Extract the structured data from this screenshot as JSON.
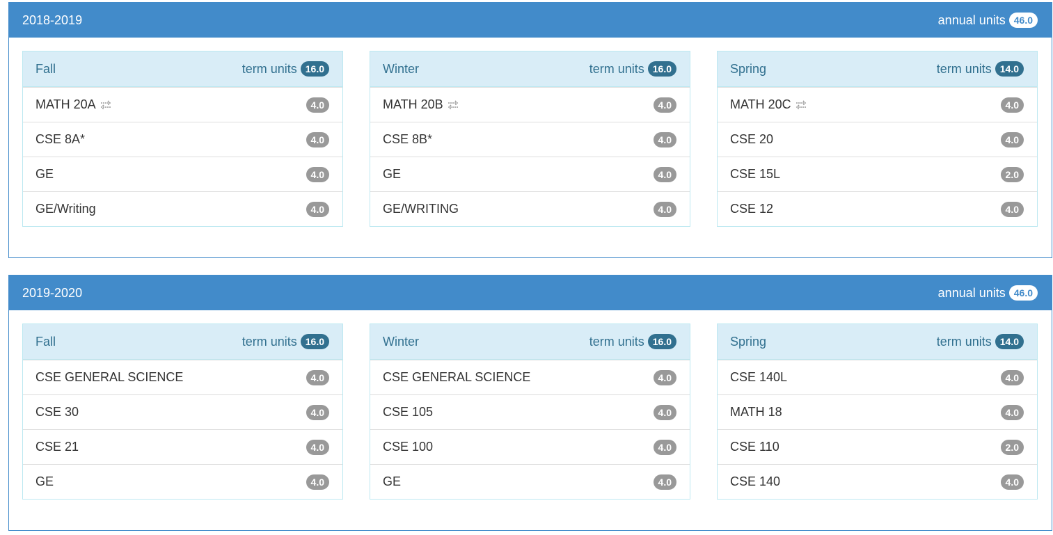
{
  "years": [
    {
      "label": "2018-2019",
      "annual_label": "annual units",
      "annual_units": "46.0",
      "terms": [
        {
          "name": "Fall",
          "units_label": "term units",
          "units": "16.0",
          "courses": [
            {
              "name": "MATH 20A",
              "units": "4.0",
              "icon": "swap-arrows-icon"
            },
            {
              "name": "CSE 8A*",
              "units": "4.0"
            },
            {
              "name": "GE",
              "units": "4.0"
            },
            {
              "name": "GE/Writing",
              "units": "4.0"
            }
          ]
        },
        {
          "name": "Winter",
          "units_label": "term units",
          "units": "16.0",
          "courses": [
            {
              "name": "MATH 20B",
              "units": "4.0",
              "icon": "swap-arrows-icon"
            },
            {
              "name": "CSE 8B*",
              "units": "4.0"
            },
            {
              "name": "GE",
              "units": "4.0"
            },
            {
              "name": "GE/WRITING",
              "units": "4.0"
            }
          ]
        },
        {
          "name": "Spring",
          "units_label": "term units",
          "units": "14.0",
          "courses": [
            {
              "name": "MATH 20C",
              "units": "4.0",
              "icon": "swap-arrows-icon"
            },
            {
              "name": "CSE 20",
              "units": "4.0"
            },
            {
              "name": "CSE 15L",
              "units": "2.0"
            },
            {
              "name": "CSE 12",
              "units": "4.0"
            }
          ]
        }
      ]
    },
    {
      "label": "2019-2020",
      "annual_label": "annual units",
      "annual_units": "46.0",
      "terms": [
        {
          "name": "Fall",
          "units_label": "term units",
          "units": "16.0",
          "courses": [
            {
              "name": "CSE GENERAL SCIENCE",
              "units": "4.0"
            },
            {
              "name": "CSE 30",
              "units": "4.0"
            },
            {
              "name": "CSE 21",
              "units": "4.0"
            },
            {
              "name": "GE",
              "units": "4.0"
            }
          ]
        },
        {
          "name": "Winter",
          "units_label": "term units",
          "units": "16.0",
          "courses": [
            {
              "name": "CSE GENERAL SCIENCE",
              "units": "4.0"
            },
            {
              "name": "CSE 105",
              "units": "4.0"
            },
            {
              "name": "CSE 100",
              "units": "4.0"
            },
            {
              "name": "GE",
              "units": "4.0"
            }
          ]
        },
        {
          "name": "Spring",
          "units_label": "term units",
          "units": "14.0",
          "courses": [
            {
              "name": "CSE 140L",
              "units": "4.0"
            },
            {
              "name": "MATH 18",
              "units": "4.0"
            },
            {
              "name": "CSE 110",
              "units": "2.0"
            },
            {
              "name": "CSE 140",
              "units": "4.0"
            }
          ]
        }
      ]
    }
  ],
  "colors": {
    "panel_primary": "#428bca",
    "term_header_bg": "#d9edf7",
    "term_header_text": "#31708f",
    "unit_badge": "#999999"
  }
}
